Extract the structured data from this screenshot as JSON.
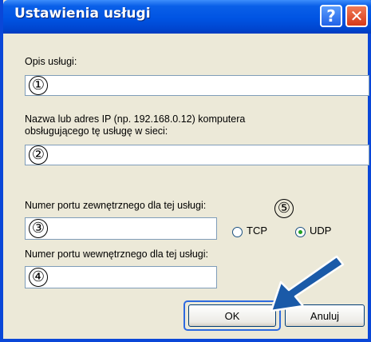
{
  "dialog": {
    "title": "Ustawienia usługi",
    "help_glyph": "?",
    "close_glyph": "✕"
  },
  "form": {
    "service_desc_label": "Opis usługi:",
    "service_desc_marker": "①",
    "host_label_line1": "Nazwa lub adres IP (np. 192.168.0.12) komputera",
    "host_label_line2": "obsługującego tę usługę w sieci:",
    "host_marker": "②",
    "ext_port_label": "Numer portu zewnętrznego dla tej usługi:",
    "ext_port_marker": "③",
    "protocol_marker": "⑤",
    "protocol_options": [
      {
        "label": "TCP",
        "selected": false
      },
      {
        "label": "UDP",
        "selected": true
      }
    ],
    "int_port_label": "Numer portu wewnętrznego dla tej usługi:",
    "int_port_marker": "④"
  },
  "buttons": {
    "ok": "OK",
    "cancel": "Anuluj"
  },
  "annotation": {
    "arrow_color": "#1a5aa8"
  }
}
